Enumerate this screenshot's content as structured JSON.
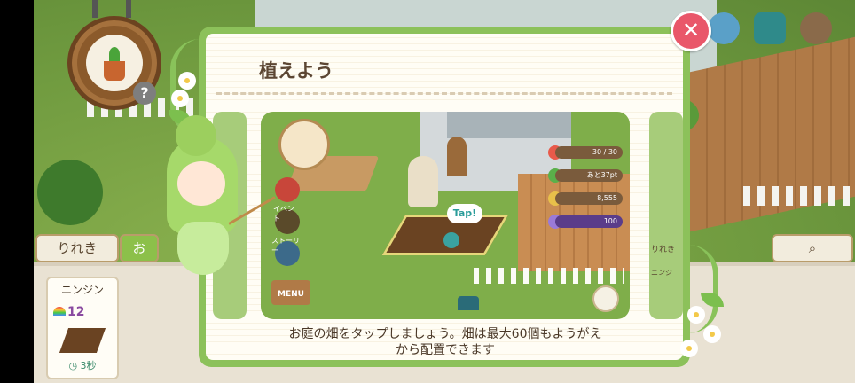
{
  "dialog": {
    "title": "植えよう",
    "caption_line1": "お庭の畑をタップしましょう。畑は最大60個もようがえ",
    "caption_line2": "から配置できます",
    "close_glyph": "✕"
  },
  "tutorial": {
    "tap_label": "Tap!",
    "menu_label": "MENU",
    "event_label": "イベント",
    "story_label": "ストーリー",
    "stats": {
      "hearts": "30 / 30",
      "exp_remaining": "あと37pt",
      "coins": "8,555",
      "stars": "100"
    }
  },
  "left_panel": {
    "history_tab": "りれき",
    "active_tab_partial": "お",
    "help_glyph": "?"
  },
  "crop_card": {
    "name": "ニンジン",
    "count": "12",
    "time": "3秒"
  },
  "right_panel": {
    "peek_label": "りれき",
    "peek_card_name": "ニンジ"
  },
  "colors": {
    "dialog_border": "#8cc15a",
    "close_button": "#e9576a",
    "title_text": "#5c4633"
  },
  "icons": [
    "sprout-icon",
    "help-icon",
    "chat-icon",
    "camera-icon",
    "settings-icon",
    "close-icon",
    "search-icon",
    "heart-icon",
    "coin-icon",
    "star-icon",
    "clock-icon",
    "rainbow-icon"
  ]
}
